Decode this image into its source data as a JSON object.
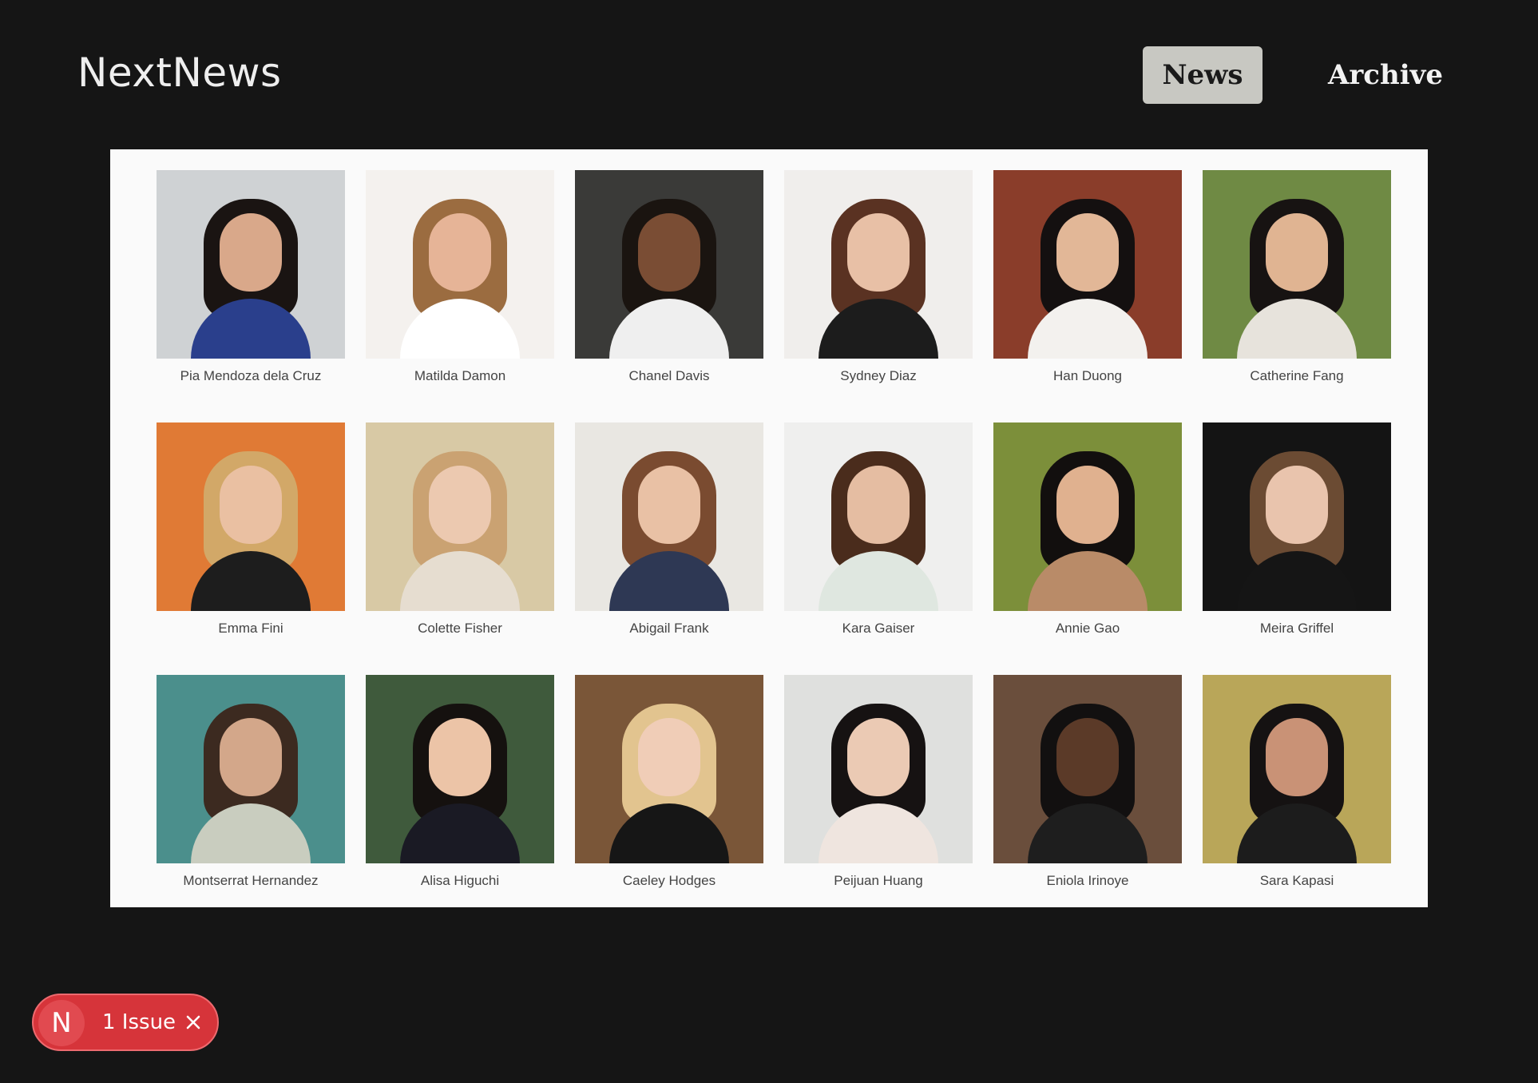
{
  "header": {
    "brand": "NextNews",
    "nav": [
      {
        "label": "News",
        "active": true
      },
      {
        "label": "Archive",
        "active": false
      }
    ]
  },
  "gallery": {
    "people": [
      {
        "name": "Pia Mendoza dela Cruz"
      },
      {
        "name": "Matilda Damon"
      },
      {
        "name": "Chanel Davis"
      },
      {
        "name": "Sydney Diaz"
      },
      {
        "name": "Han Duong"
      },
      {
        "name": "Catherine Fang"
      },
      {
        "name": "Emma Fini"
      },
      {
        "name": "Colette Fisher"
      },
      {
        "name": "Abigail Frank"
      },
      {
        "name": "Kara Gaiser"
      },
      {
        "name": "Annie Gao"
      },
      {
        "name": "Meira Griffel"
      },
      {
        "name": "Montserrat Hernandez"
      },
      {
        "name": "Alisa Higuchi"
      },
      {
        "name": "Caeley Hodges"
      },
      {
        "name": "Peijuan Huang"
      },
      {
        "name": "Eniola Irinoye"
      },
      {
        "name": "Sara Kapasi"
      }
    ]
  },
  "issues_badge": {
    "logo_letter": "N",
    "label": "1 Issue",
    "close_icon": "close-icon"
  },
  "colors": {
    "background": "#151515",
    "active_nav_bg": "#c8c8c2",
    "badge_red": "#d6343a"
  }
}
